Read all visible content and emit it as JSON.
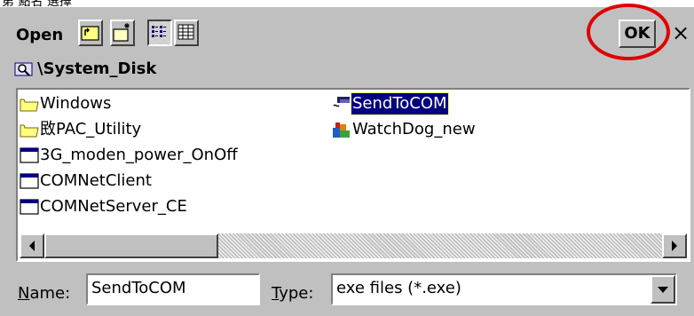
{
  "top_fragment": "第     點名        選擇",
  "toolbar": {
    "title": "Open",
    "ok_label": "OK",
    "close_label": "×"
  },
  "location": {
    "path": "\\System_Disk"
  },
  "files": [
    {
      "label": "Windows",
      "icon": "folder-icon"
    },
    {
      "label": "敃PAC_Utility",
      "icon": "folder-icon"
    },
    {
      "label": "3G_moden_power_OnOff",
      "icon": "application-window-icon"
    },
    {
      "label": "COMNetClient",
      "icon": "application-window-icon"
    },
    {
      "label": "COMNetServer_CE",
      "icon": "application-window-icon"
    },
    {
      "label": "SendToCOM",
      "icon": "serial-port-app-icon",
      "selected": true
    },
    {
      "label": "WatchDog_new",
      "icon": "watchdog-app-icon"
    }
  ],
  "footer": {
    "name_label_accel": "N",
    "name_label_rest": "ame:",
    "name_value": "SendToCOM",
    "type_label_accel": "T",
    "type_label_rest": "ype:",
    "type_value": "exe files (*.exe)"
  },
  "colors": {
    "dialog_bg": "#c0c0c0",
    "selection_bg": "#000080",
    "annotation_ring": "#e00000"
  }
}
